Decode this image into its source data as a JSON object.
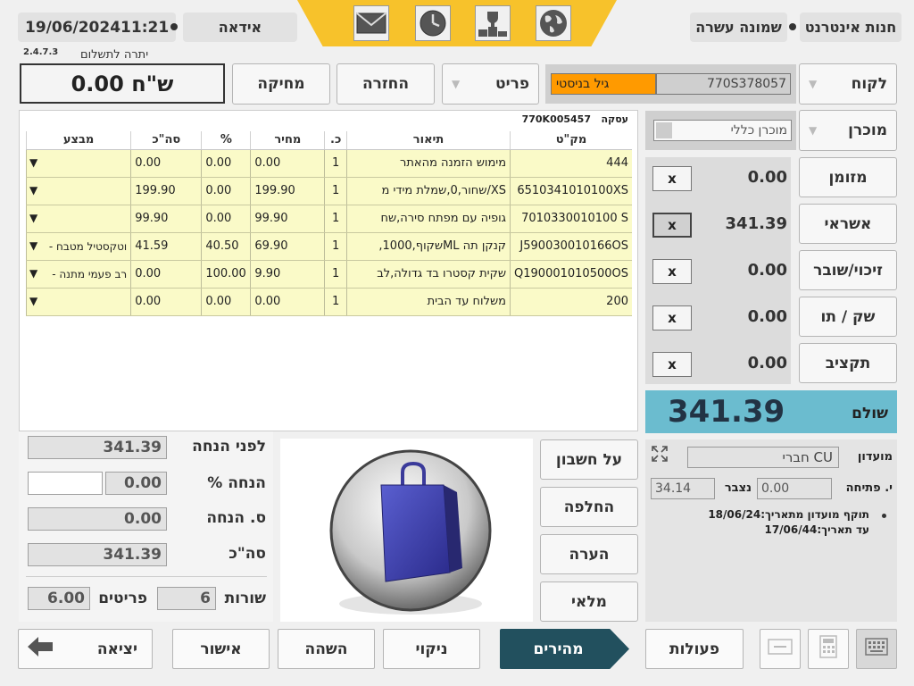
{
  "header": {
    "date": "19/06/2024",
    "time": "11:21",
    "user": "אידאה",
    "store": "חנות אינטרנט",
    "branch": "שמונה עשרה",
    "version": "2.4.7.3",
    "accent": "#f7c22b"
  },
  "balance": {
    "label": "יתרה לתשלום",
    "value": "0.00 ש\"ח"
  },
  "actions": {
    "delete": "מחיקה",
    "return": "החזרה",
    "item": "פריט"
  },
  "customer": {
    "label": "לקוח",
    "id": "770S378057",
    "name": "גיל בניסטי",
    "name_color": "#ff9a00"
  },
  "seller": {
    "label": "מוכרן",
    "value": "מוכרן כללי"
  },
  "transaction": {
    "label": "עסקה",
    "id": "770K005457"
  },
  "grid": {
    "columns": [
      "מק\"ט",
      "תיאור",
      "כ.",
      "מחיר",
      "%",
      "סה\"כ",
      "מבצע"
    ],
    "rows": [
      {
        "sku": "444",
        "desc": "מימוש הזמנה מהאתר",
        "qty": "1",
        "price": "0.00",
        "pct": "0.00",
        "total": "0.00",
        "promo": ""
      },
      {
        "sku": "6510341010100XS",
        "desc": "XS/שחור,0,שמלת מידי מ",
        "qty": "1",
        "price": "199.90",
        "pct": "0.00",
        "total": "199.90",
        "promo": ""
      },
      {
        "sku": "7010330010100 S",
        "desc": "גופיה עם מפתח סירה,שח",
        "qty": "1",
        "price": "99.90",
        "pct": "0.00",
        "total": "99.90",
        "promo": ""
      },
      {
        "sku": "J590030010166OS",
        "desc": "קנקן תה MLשקוף,1000,",
        "qty": "1",
        "price": "69.90",
        "pct": "40.50",
        "total": "41.59",
        "promo": "וטקסטיל מטבח -"
      },
      {
        "sku": "Q190001010500OS",
        "desc": "שקית קסטרו בד גדולה,לב",
        "qty": "1",
        "price": "9.90",
        "pct": "100.00",
        "total": "0.00",
        "promo": "רב פעמי מתנה -"
      },
      {
        "sku": "200",
        "desc": "משלוח עד הבית",
        "qty": "1",
        "price": "0.00",
        "pct": "0.00",
        "total": "0.00",
        "promo": ""
      }
    ],
    "promo_arrow": "▼"
  },
  "payments": [
    {
      "label": "מזומן",
      "value": "0.00",
      "x": "x"
    },
    {
      "label": "אשראי",
      "value": "341.39",
      "x": "x"
    },
    {
      "label": "זיכוי/שובר",
      "value": "0.00",
      "x": "x"
    },
    {
      "label": "שק / תו",
      "value": "0.00",
      "x": "x"
    },
    {
      "label": "תקציב",
      "value": "0.00",
      "x": "x"
    }
  ],
  "paid": {
    "label": "שולם",
    "value": "341.39",
    "bg": "#6bbccf"
  },
  "totals": {
    "before_discount_label": "לפני הנחה",
    "before_discount": "341.39",
    "discount_pct_label": "% הנחה",
    "discount_pct": "0.00",
    "discount_sum_label": "ס. הנחה",
    "discount_sum": "0.00",
    "total_label": "סה\"כ",
    "total": "341.39",
    "lines_label": "שורות",
    "lines": "6",
    "items_label": "פריטים",
    "items": "6.00"
  },
  "side_buttons": {
    "on_account": "על חשבון",
    "exchange": "החלפה",
    "note": "הערה",
    "stock": "מלאי"
  },
  "club": {
    "label": "מועדון",
    "value": "חברי CU",
    "opening_label": "י. פתיחה",
    "opening": "0.00",
    "accrued_label": "נצבר",
    "accrued": "34.14",
    "valid_from": "תוקף מועדון מתאריך:18/06/24",
    "valid_to": "עד תאריך:17/06/44"
  },
  "bottom": {
    "exit": "יציאה",
    "approve": "אישור",
    "hold": "השהה",
    "clear": "ניקוי",
    "fast": "מהירים",
    "actions": "פעולות",
    "fast_color": "#22505e"
  }
}
